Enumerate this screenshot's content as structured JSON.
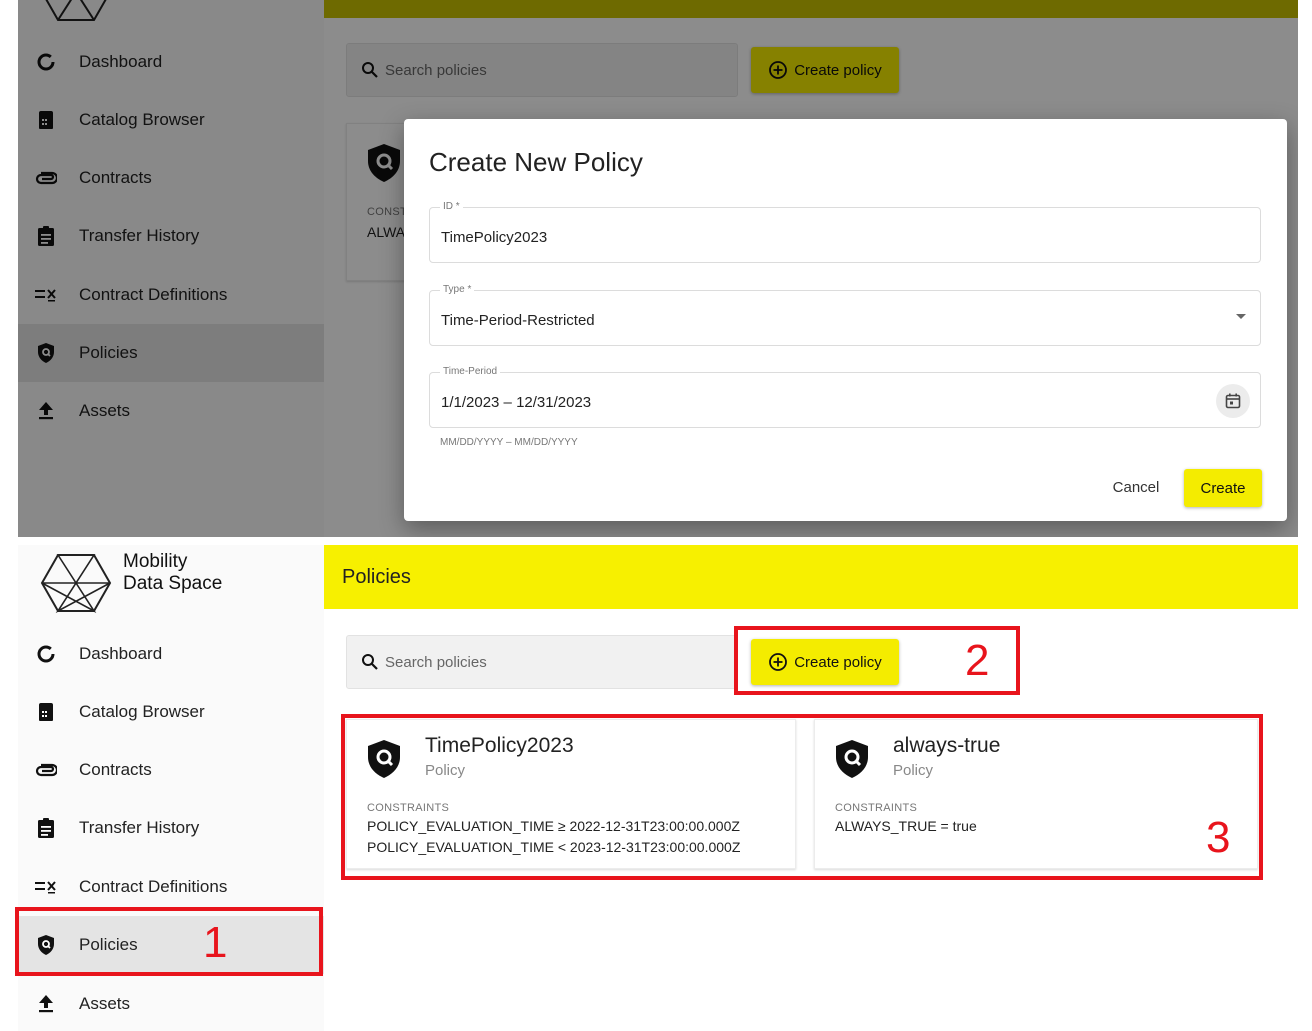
{
  "app": {
    "logo_line1": "Mobility",
    "logo_line2": "Data Space"
  },
  "sidebar": {
    "items": [
      {
        "label": "Dashboard",
        "icon": "dashboard-icon"
      },
      {
        "label": "Catalog Browser",
        "icon": "catalog-icon"
      },
      {
        "label": "Contracts",
        "icon": "paperclip-icon"
      },
      {
        "label": "Transfer History",
        "icon": "clipboard-icon"
      },
      {
        "label": "Contract Definitions",
        "icon": "contract-definitions-icon"
      },
      {
        "label": "Policies",
        "icon": "shield-icon",
        "active": true
      },
      {
        "label": "Assets",
        "icon": "upload-icon"
      }
    ]
  },
  "page": {
    "title": "Policies",
    "search_placeholder": "Search policies",
    "create_label": "Create policy"
  },
  "background_card": {
    "constraints_label": "CONSTR",
    "constraint_line": "ALWA"
  },
  "dialog": {
    "title": "Create New Policy",
    "id_label": "ID *",
    "id_value": "TimePolicy2023",
    "type_label": "Type *",
    "type_value": "Time-Period-Restricted",
    "period_label": "Time-Period",
    "period_value": "1/1/2023 – 12/31/2023",
    "period_hint": "MM/DD/YYYY – MM/DD/YYYY",
    "cancel_label": "Cancel",
    "create_label": "Create"
  },
  "policies": [
    {
      "name": "TimePolicy2023",
      "kind": "Policy",
      "constraints_label": "CONSTRAINTS",
      "constraints": [
        "POLICY_EVALUATION_TIME ≥ 2022-12-31T23:00:00.000Z",
        "POLICY_EVALUATION_TIME < 2023-12-31T23:00:00.000Z"
      ]
    },
    {
      "name": "always-true",
      "kind": "Policy",
      "constraints_label": "CONSTRAINTS",
      "constraints": [
        "ALWAYS_TRUE = true"
      ]
    }
  ],
  "annotations": [
    "1",
    "2",
    "3"
  ],
  "colors": {
    "accent": "#f4ec00",
    "annotation": "#e8141c"
  }
}
